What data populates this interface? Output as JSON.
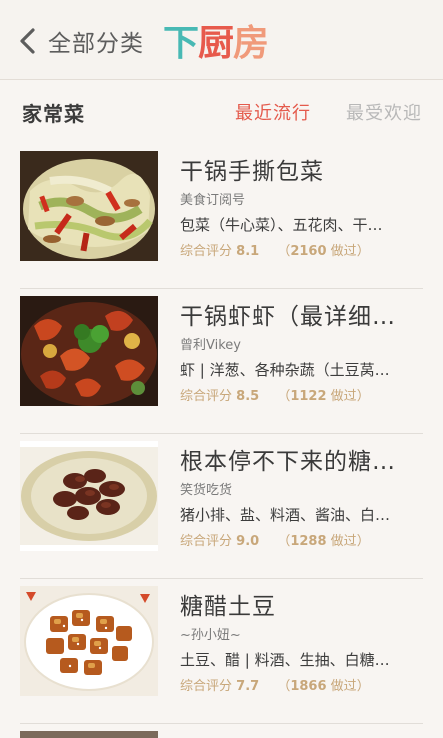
{
  "header": {
    "back_label": "全部分类",
    "brand": {
      "c1": "下",
      "c2": "厨",
      "c3": "房"
    },
    "colors": {
      "teal": "#48b9b4",
      "red": "#e75a4c",
      "peach": "#f09a7a"
    }
  },
  "section": {
    "title": "家常菜",
    "tabs": [
      {
        "label": "最近流行",
        "active": true
      },
      {
        "label": "最受欢迎",
        "active": false
      }
    ]
  },
  "recipes": [
    {
      "name": "干锅手撕包菜",
      "author": "美食订阅号",
      "ingredients": "包菜（牛心菜）、五花肉、干…",
      "rating_label": "综合评分",
      "score": "8.1",
      "count": "2160",
      "count_suffix": "做过"
    },
    {
      "name": "干锅虾虾（最详细…",
      "author": "曾利Vikey",
      "ingredients": "虾 | 洋葱、各种杂蔬（土豆莴…",
      "rating_label": "综合评分",
      "score": "8.5",
      "count": "1122",
      "count_suffix": "做过"
    },
    {
      "name": "根本停不下来的糖…",
      "author": "笑货吃货",
      "ingredients": "猪小排、盐、料酒、酱油、白…",
      "rating_label": "综合评分",
      "score": "9.0",
      "count": "1288",
      "count_suffix": "做过"
    },
    {
      "name": "糖醋土豆",
      "author": "~孙小妞~",
      "ingredients": "土豆、醋 | 料酒、生抽、白糖…",
      "rating_label": "综合评分",
      "score": "7.7",
      "count": "1866",
      "count_suffix": "做过"
    }
  ]
}
